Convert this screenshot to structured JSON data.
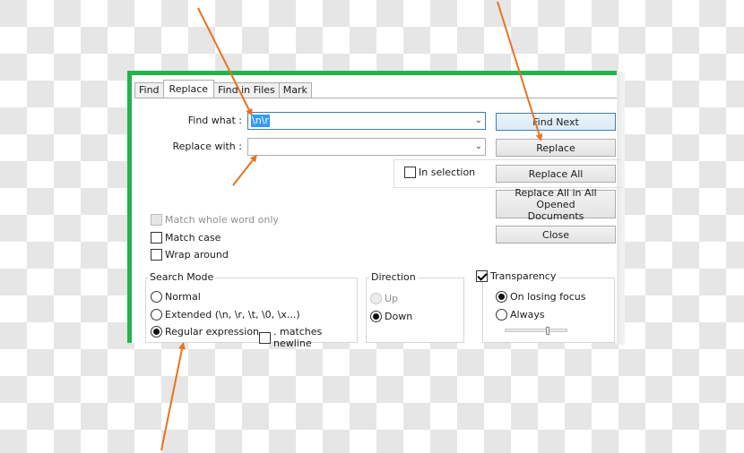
{
  "tabs": [
    {
      "label": "Find",
      "active": false
    },
    {
      "label": "Replace",
      "active": true
    },
    {
      "label": "Find in Files",
      "active": false
    },
    {
      "label": "Mark",
      "active": false
    }
  ],
  "find_what": {
    "label": "Find what :",
    "value": "\\n\\r"
  },
  "replace_with": {
    "label": "Replace with :",
    "value": ""
  },
  "buttons": {
    "find_next": "Find Next",
    "replace": "Replace",
    "replace_all": "Replace All",
    "replace_all_opened_line1": "Replace All in All Opened",
    "replace_all_opened_line2": "Documents",
    "close": "Close"
  },
  "in_selection": {
    "label": "In selection",
    "checked": false
  },
  "options": {
    "match_whole_word": {
      "label": "Match whole word only",
      "checked": false,
      "disabled": true
    },
    "match_case": {
      "label": "Match case",
      "checked": false
    },
    "wrap_around": {
      "label": "Wrap around",
      "checked": false
    }
  },
  "search_mode": {
    "title": "Search Mode",
    "normal": "Normal",
    "extended": "Extended (\\n, \\r, \\t, \\0, \\x...)",
    "regex": "Regular expression",
    "matches_newline": ". matches newline",
    "selected": "regex"
  },
  "direction": {
    "title": "Direction",
    "up": "Up",
    "down": "Down",
    "selected": "down"
  },
  "transparency": {
    "label": "Transparency",
    "checked": true,
    "on_losing_focus": "On losing focus",
    "always": "Always",
    "selected": "on_losing_focus",
    "slider_value_fraction": 0.68
  },
  "colors": {
    "frame_green": "#21b44b",
    "arrow_orange": "#e8731f",
    "selection_blue": "#3399ff"
  }
}
